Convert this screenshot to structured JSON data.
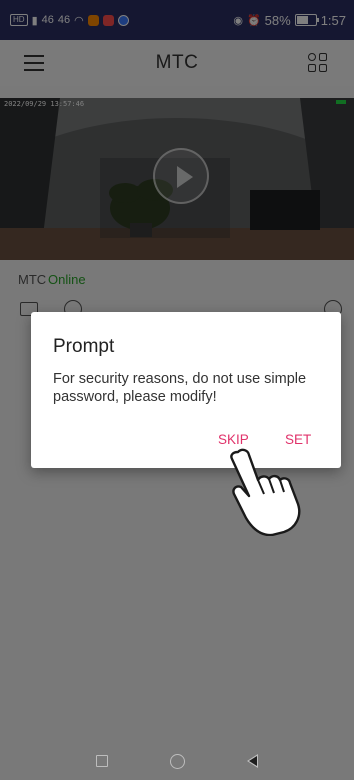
{
  "status_bar": {
    "left_chip": "HD",
    "signal_1": "46",
    "signal_2": "46",
    "battery_percent": "58%",
    "time": "1:57"
  },
  "header": {
    "title": "MTC",
    "menu_icon": "hamburger-menu-icon",
    "layout_icon": "grid-layout-icon"
  },
  "camera": {
    "timestamp": "2022/09/29 13:57:46",
    "play_icon": "play-icon"
  },
  "device": {
    "name": "MTC",
    "status": "Online",
    "status_color": "#2aa52a",
    "icons": [
      "folder-icon",
      "message-icon",
      "settings-icon"
    ]
  },
  "dialog": {
    "title": "Prompt",
    "message": "For security reasons, do not use simple password, please modify!",
    "skip_label": "SKIP",
    "set_label": "SET",
    "accent_color": "#e0336b"
  },
  "nav_bar": {
    "icons": [
      "recent-apps-icon",
      "home-icon",
      "back-icon"
    ]
  }
}
